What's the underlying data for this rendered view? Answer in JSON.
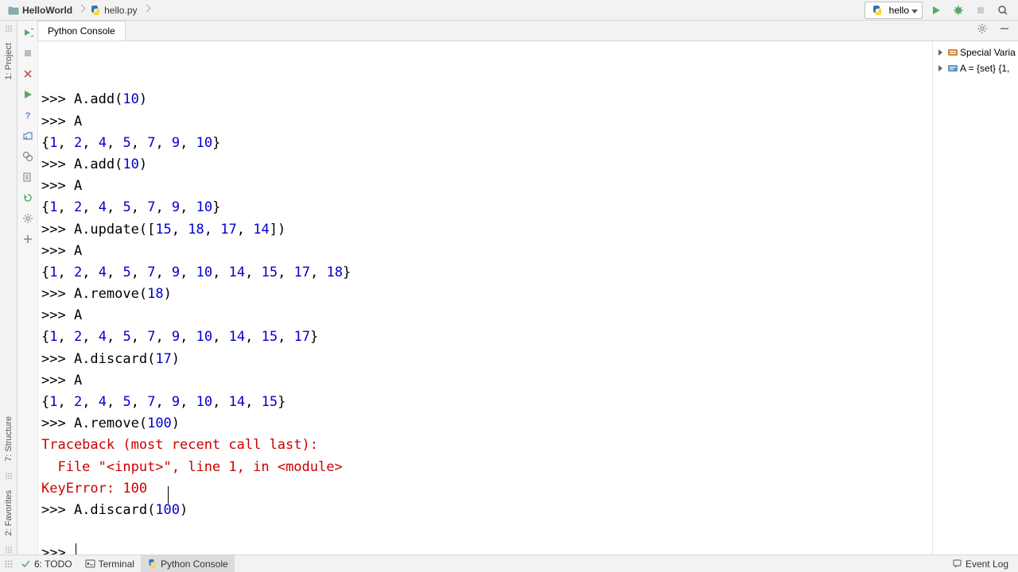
{
  "breadcrumbs": {
    "project": "HelloWorld",
    "file": "hello.py"
  },
  "run_config": {
    "selected": "hello"
  },
  "console": {
    "tab_label": "Python Console",
    "lines": [
      {
        "type": "in",
        "tokens": [
          {
            "t": "A.add(",
            "c": "p"
          },
          {
            "t": "10",
            "c": "n"
          },
          {
            "t": ")",
            "c": "p"
          }
        ]
      },
      {
        "type": "in",
        "tokens": [
          {
            "t": "A",
            "c": "p"
          }
        ]
      },
      {
        "type": "out",
        "tokens": [
          {
            "t": "{",
            "c": "p"
          },
          {
            "t": "1",
            "c": "n"
          },
          {
            "t": ", ",
            "c": "p"
          },
          {
            "t": "2",
            "c": "n"
          },
          {
            "t": ", ",
            "c": "p"
          },
          {
            "t": "4",
            "c": "n"
          },
          {
            "t": ", ",
            "c": "p"
          },
          {
            "t": "5",
            "c": "n"
          },
          {
            "t": ", ",
            "c": "p"
          },
          {
            "t": "7",
            "c": "n"
          },
          {
            "t": ", ",
            "c": "p"
          },
          {
            "t": "9",
            "c": "n"
          },
          {
            "t": ", ",
            "c": "p"
          },
          {
            "t": "10",
            "c": "n"
          },
          {
            "t": "}",
            "c": "p"
          }
        ]
      },
      {
        "type": "in",
        "tokens": [
          {
            "t": "A.add(",
            "c": "p"
          },
          {
            "t": "10",
            "c": "n"
          },
          {
            "t": ")",
            "c": "p"
          }
        ]
      },
      {
        "type": "in",
        "tokens": [
          {
            "t": "A",
            "c": "p"
          }
        ]
      },
      {
        "type": "out",
        "tokens": [
          {
            "t": "{",
            "c": "p"
          },
          {
            "t": "1",
            "c": "n"
          },
          {
            "t": ", ",
            "c": "p"
          },
          {
            "t": "2",
            "c": "n"
          },
          {
            "t": ", ",
            "c": "p"
          },
          {
            "t": "4",
            "c": "n"
          },
          {
            "t": ", ",
            "c": "p"
          },
          {
            "t": "5",
            "c": "n"
          },
          {
            "t": ", ",
            "c": "p"
          },
          {
            "t": "7",
            "c": "n"
          },
          {
            "t": ", ",
            "c": "p"
          },
          {
            "t": "9",
            "c": "n"
          },
          {
            "t": ", ",
            "c": "p"
          },
          {
            "t": "10",
            "c": "n"
          },
          {
            "t": "}",
            "c": "p"
          }
        ]
      },
      {
        "type": "in",
        "tokens": [
          {
            "t": "A.update([",
            "c": "p"
          },
          {
            "t": "15",
            "c": "n"
          },
          {
            "t": ", ",
            "c": "p"
          },
          {
            "t": "18",
            "c": "n"
          },
          {
            "t": ", ",
            "c": "p"
          },
          {
            "t": "17",
            "c": "n"
          },
          {
            "t": ", ",
            "c": "p"
          },
          {
            "t": "14",
            "c": "n"
          },
          {
            "t": "])",
            "c": "p"
          }
        ]
      },
      {
        "type": "in",
        "tokens": [
          {
            "t": "A",
            "c": "p"
          }
        ]
      },
      {
        "type": "out",
        "tokens": [
          {
            "t": "{",
            "c": "p"
          },
          {
            "t": "1",
            "c": "n"
          },
          {
            "t": ", ",
            "c": "p"
          },
          {
            "t": "2",
            "c": "n"
          },
          {
            "t": ", ",
            "c": "p"
          },
          {
            "t": "4",
            "c": "n"
          },
          {
            "t": ", ",
            "c": "p"
          },
          {
            "t": "5",
            "c": "n"
          },
          {
            "t": ", ",
            "c": "p"
          },
          {
            "t": "7",
            "c": "n"
          },
          {
            "t": ", ",
            "c": "p"
          },
          {
            "t": "9",
            "c": "n"
          },
          {
            "t": ", ",
            "c": "p"
          },
          {
            "t": "10",
            "c": "n"
          },
          {
            "t": ", ",
            "c": "p"
          },
          {
            "t": "14",
            "c": "n"
          },
          {
            "t": ", ",
            "c": "p"
          },
          {
            "t": "15",
            "c": "n"
          },
          {
            "t": ", ",
            "c": "p"
          },
          {
            "t": "17",
            "c": "n"
          },
          {
            "t": ", ",
            "c": "p"
          },
          {
            "t": "18",
            "c": "n"
          },
          {
            "t": "}",
            "c": "p"
          }
        ]
      },
      {
        "type": "in",
        "tokens": [
          {
            "t": "A.remove(",
            "c": "p"
          },
          {
            "t": "18",
            "c": "n"
          },
          {
            "t": ")",
            "c": "p"
          }
        ]
      },
      {
        "type": "in",
        "tokens": [
          {
            "t": "A",
            "c": "p"
          }
        ]
      },
      {
        "type": "out",
        "tokens": [
          {
            "t": "{",
            "c": "p"
          },
          {
            "t": "1",
            "c": "n"
          },
          {
            "t": ", ",
            "c": "p"
          },
          {
            "t": "2",
            "c": "n"
          },
          {
            "t": ", ",
            "c": "p"
          },
          {
            "t": "4",
            "c": "n"
          },
          {
            "t": ", ",
            "c": "p"
          },
          {
            "t": "5",
            "c": "n"
          },
          {
            "t": ", ",
            "c": "p"
          },
          {
            "t": "7",
            "c": "n"
          },
          {
            "t": ", ",
            "c": "p"
          },
          {
            "t": "9",
            "c": "n"
          },
          {
            "t": ", ",
            "c": "p"
          },
          {
            "t": "10",
            "c": "n"
          },
          {
            "t": ", ",
            "c": "p"
          },
          {
            "t": "14",
            "c": "n"
          },
          {
            "t": ", ",
            "c": "p"
          },
          {
            "t": "15",
            "c": "n"
          },
          {
            "t": ", ",
            "c": "p"
          },
          {
            "t": "17",
            "c": "n"
          },
          {
            "t": "}",
            "c": "p"
          }
        ]
      },
      {
        "type": "in",
        "tokens": [
          {
            "t": "A.discard(",
            "c": "p"
          },
          {
            "t": "17",
            "c": "n"
          },
          {
            "t": ")",
            "c": "p"
          }
        ]
      },
      {
        "type": "in",
        "tokens": [
          {
            "t": "A",
            "c": "p"
          }
        ]
      },
      {
        "type": "out",
        "tokens": [
          {
            "t": "{",
            "c": "p"
          },
          {
            "t": "1",
            "c": "n"
          },
          {
            "t": ", ",
            "c": "p"
          },
          {
            "t": "2",
            "c": "n"
          },
          {
            "t": ", ",
            "c": "p"
          },
          {
            "t": "4",
            "c": "n"
          },
          {
            "t": ", ",
            "c": "p"
          },
          {
            "t": "5",
            "c": "n"
          },
          {
            "t": ", ",
            "c": "p"
          },
          {
            "t": "7",
            "c": "n"
          },
          {
            "t": ", ",
            "c": "p"
          },
          {
            "t": "9",
            "c": "n"
          },
          {
            "t": ", ",
            "c": "p"
          },
          {
            "t": "10",
            "c": "n"
          },
          {
            "t": ", ",
            "c": "p"
          },
          {
            "t": "14",
            "c": "n"
          },
          {
            "t": ", ",
            "c": "p"
          },
          {
            "t": "15",
            "c": "n"
          },
          {
            "t": "}",
            "c": "p"
          }
        ]
      },
      {
        "type": "in",
        "tokens": [
          {
            "t": "A.remove(",
            "c": "p"
          },
          {
            "t": "100",
            "c": "n"
          },
          {
            "t": ")",
            "c": "p"
          }
        ]
      },
      {
        "type": "err",
        "tokens": [
          {
            "t": "Traceback (most recent call last):",
            "c": "e"
          }
        ]
      },
      {
        "type": "err",
        "tokens": [
          {
            "t": "  File \"<input>\", line ",
            "c": "e"
          },
          {
            "t": "1",
            "c": "e"
          },
          {
            "t": ", in <module>",
            "c": "e"
          }
        ]
      },
      {
        "type": "err",
        "tokens": [
          {
            "t": "KeyError: ",
            "c": "e"
          },
          {
            "t": "100",
            "c": "e"
          }
        ]
      },
      {
        "type": "in",
        "tokens": [
          {
            "t": "A.discard(",
            "c": "p"
          },
          {
            "t": "100",
            "c": "n"
          },
          {
            "t": ")",
            "c": "p"
          }
        ]
      },
      {
        "type": "blank"
      },
      {
        "type": "prompt"
      }
    ],
    "prompt_text": ">>> "
  },
  "variables": {
    "rows": [
      {
        "label": "Special Varia"
      },
      {
        "label": "A = {set} {1,"
      }
    ]
  },
  "left_edge": {
    "top": "1: Project",
    "mid": "7: Structure",
    "bot": "2: Favorites"
  },
  "statusbar": {
    "todo": "6: TODO",
    "terminal": "Terminal",
    "python_console": "Python Console",
    "event_log": "Event Log"
  }
}
